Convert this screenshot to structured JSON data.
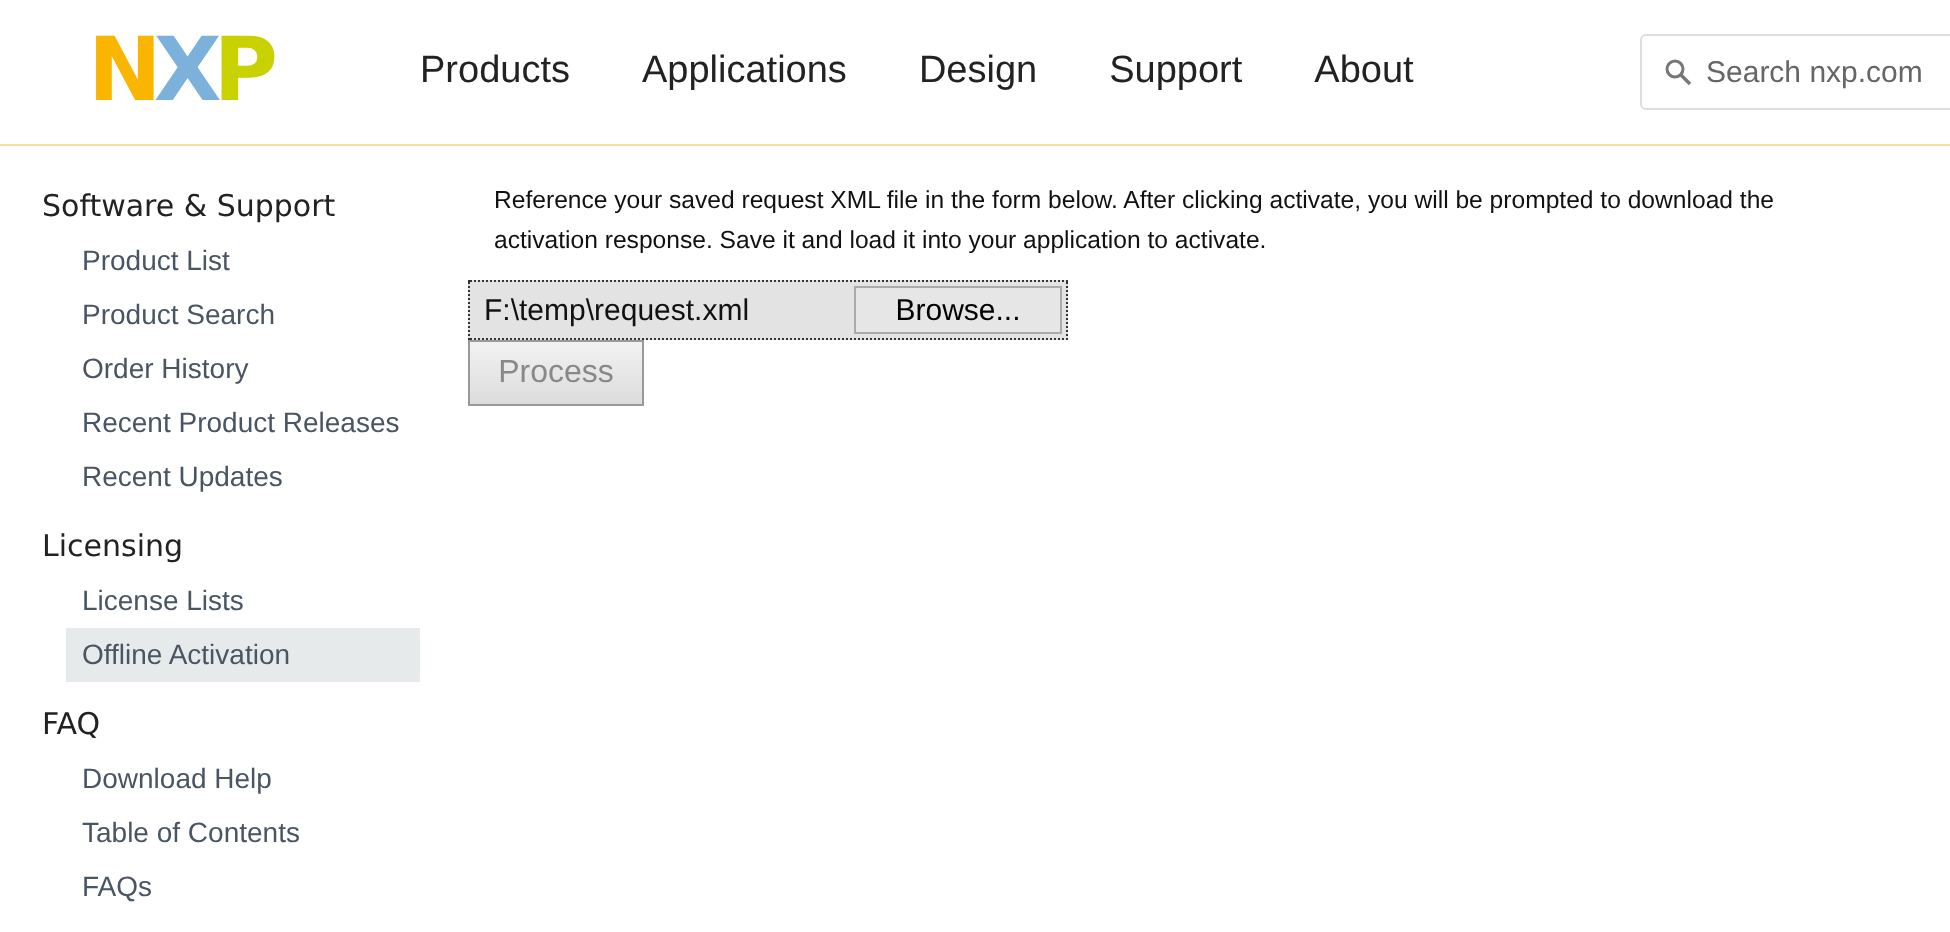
{
  "header": {
    "logo": "NXP",
    "nav": [
      "Products",
      "Applications",
      "Design",
      "Support",
      "About"
    ],
    "search": {
      "placeholder": "Search nxp.com"
    }
  },
  "sidebar": [
    {
      "heading": "Software & Support",
      "items": [
        {
          "label": "Product List",
          "selected": false
        },
        {
          "label": "Product Search",
          "selected": false
        },
        {
          "label": "Order History",
          "selected": false
        },
        {
          "label": "Recent Product Releases",
          "selected": false
        },
        {
          "label": "Recent Updates",
          "selected": false
        }
      ]
    },
    {
      "heading": "Licensing",
      "items": [
        {
          "label": "License Lists",
          "selected": false
        },
        {
          "label": "Offline Activation",
          "selected": true
        }
      ]
    },
    {
      "heading": "FAQ",
      "items": [
        {
          "label": "Download Help",
          "selected": false
        },
        {
          "label": "Table of Contents",
          "selected": false
        },
        {
          "label": "FAQs",
          "selected": false
        }
      ]
    }
  ],
  "main": {
    "instructions": "Reference your saved request XML file in the form below. After clicking activate, you will be prompted to download the activation response. Save it and load it into your application to activate.",
    "file_value": "F:\\temp\\request.xml",
    "browse_label": "Browse...",
    "process": {
      "label": "Process",
      "disabled": true
    }
  }
}
